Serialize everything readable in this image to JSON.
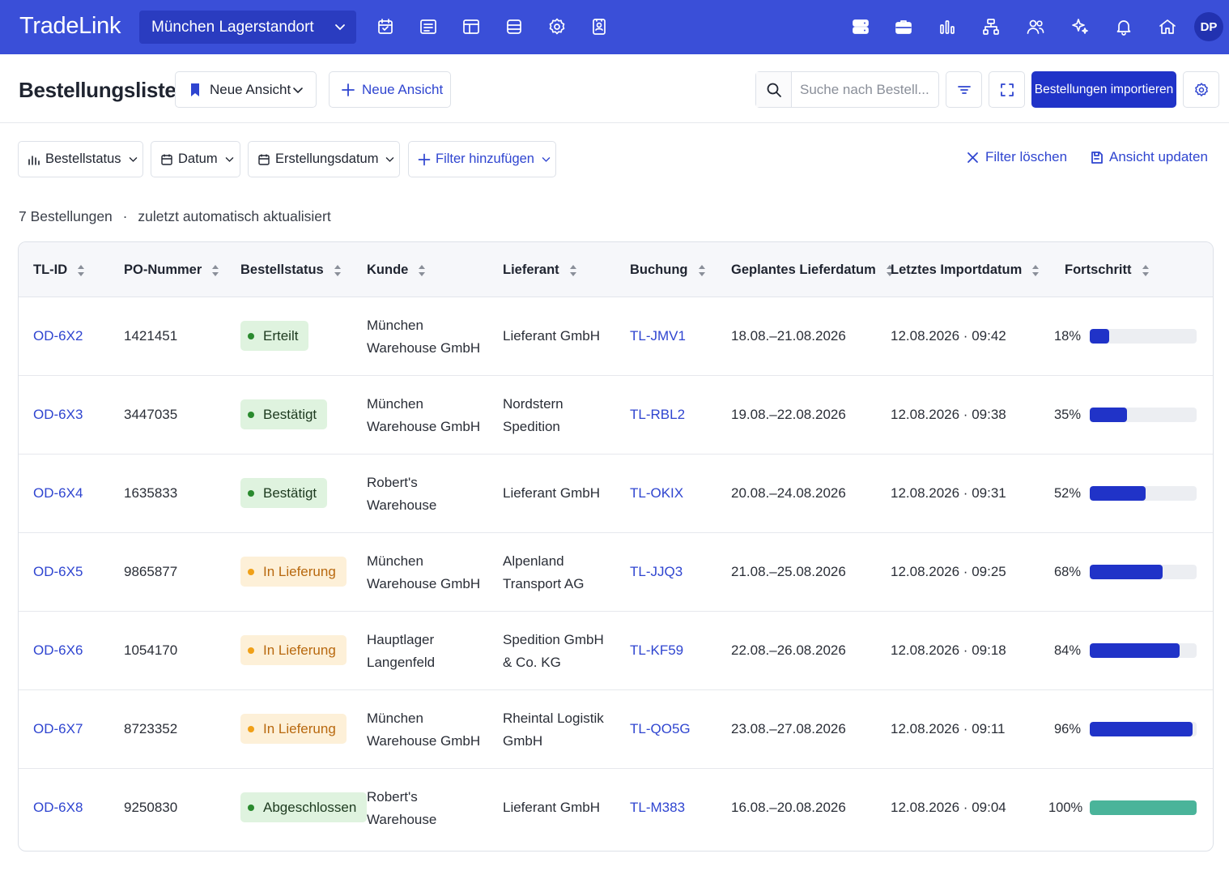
{
  "app": {
    "brand": "TradeLink",
    "location": "München Lagerstandort",
    "avatar_initials": "DP"
  },
  "header": {
    "title": "Bestellungsliste",
    "view_button": "Neue Ansicht",
    "new_view_button": "Neue Ansicht",
    "search_placeholder": "Suche nach Bestell...",
    "import_button": "Bestellungen importieren"
  },
  "filters": {
    "status": "Bestellstatus",
    "date": "Datum",
    "created": "Erstellungsdatum",
    "add": "Filter hinzufügen",
    "clear": "Filter löschen",
    "update_view": "Ansicht updaten"
  },
  "summary": {
    "count": "7 Bestellungen",
    "separator": "·",
    "note": "zuletzt automatisch aktualisiert"
  },
  "table": {
    "columns": [
      "TL-ID",
      "PO-Nummer",
      "Bestellstatus",
      "Kunde",
      "Lieferant",
      "Buchung",
      "Geplantes Lieferdatum",
      "Letztes Importdatum",
      "Fortschritt"
    ],
    "rows": [
      {
        "id": "OD-6X2",
        "po": "1421451",
        "status": "Erteilt",
        "status_type": "green",
        "customer": [
          "München",
          "Warehouse GmbH"
        ],
        "supplier": [
          "Lieferant GmbH"
        ],
        "booking": "TL-JMV1",
        "planned": "18.08.–21.08.2026",
        "imported": "12.08.2026 · 09:42",
        "progress_label": "18%",
        "progress": 0.18,
        "bar_color": "#2033c8"
      },
      {
        "id": "OD-6X3",
        "po": "3447035",
        "status": "Bestätigt",
        "status_type": "green",
        "customer": [
          "München",
          "Warehouse GmbH"
        ],
        "supplier": [
          "Nordstern",
          "Spedition"
        ],
        "booking": "TL-RBL2",
        "planned": "19.08.–22.08.2026",
        "imported": "12.08.2026 · 09:38",
        "progress_label": "35%",
        "progress": 0.35,
        "bar_color": "#2033c8"
      },
      {
        "id": "OD-6X4",
        "po": "1635833",
        "status": "Bestätigt",
        "status_type": "green",
        "customer": [
          "Robert's",
          "Warehouse"
        ],
        "supplier": [
          "Lieferant GmbH"
        ],
        "booking": "TL-OKIX",
        "planned": "20.08.–24.08.2026",
        "imported": "12.08.2026 · 09:31",
        "progress_label": "52%",
        "progress": 0.52,
        "bar_color": "#2033c8"
      },
      {
        "id": "OD-6X5",
        "po": "9865877",
        "status": "In Lieferung",
        "status_type": "orange",
        "customer": [
          "München",
          "Warehouse GmbH"
        ],
        "supplier": [
          "Alpenland",
          "Transport AG"
        ],
        "booking": "TL-JJQ3",
        "planned": "21.08.–25.08.2026",
        "imported": "12.08.2026 · 09:25",
        "progress_label": "68%",
        "progress": 0.68,
        "bar_color": "#2033c8"
      },
      {
        "id": "OD-6X6",
        "po": "1054170",
        "status": "In Lieferung",
        "status_type": "orange",
        "customer": [
          "Hauptlager",
          "Langenfeld"
        ],
        "supplier": [
          "Spedition GmbH",
          "& Co. KG"
        ],
        "booking": "TL-KF59",
        "planned": "22.08.–26.08.2026",
        "imported": "12.08.2026 · 09:18",
        "progress_label": "84%",
        "progress": 0.84,
        "bar_color": "#2033c8"
      },
      {
        "id": "OD-6X7",
        "po": "8723352",
        "status": "In Lieferung",
        "status_type": "orange",
        "customer": [
          "München",
          "Warehouse GmbH"
        ],
        "supplier": [
          "Rheintal Logistik",
          "GmbH"
        ],
        "booking": "TL-QO5G",
        "planned": "23.08.–27.08.2026",
        "imported": "12.08.2026 · 09:11",
        "progress_label": "96%",
        "progress": 0.96,
        "bar_color": "#2033c8"
      },
      {
        "id": "OD-6X8",
        "po": "9250830",
        "status": "Abgeschlossen",
        "status_type": "green",
        "customer": [
          "Robert's",
          "Warehouse"
        ],
        "supplier": [
          "Lieferant GmbH"
        ],
        "booking": "TL-M383",
        "planned": "16.08.–20.08.2026",
        "imported": "12.08.2026 · 09:04",
        "progress_label": "100%",
        "progress": 1.0,
        "bar_color": "#4ab49a"
      }
    ]
  }
}
